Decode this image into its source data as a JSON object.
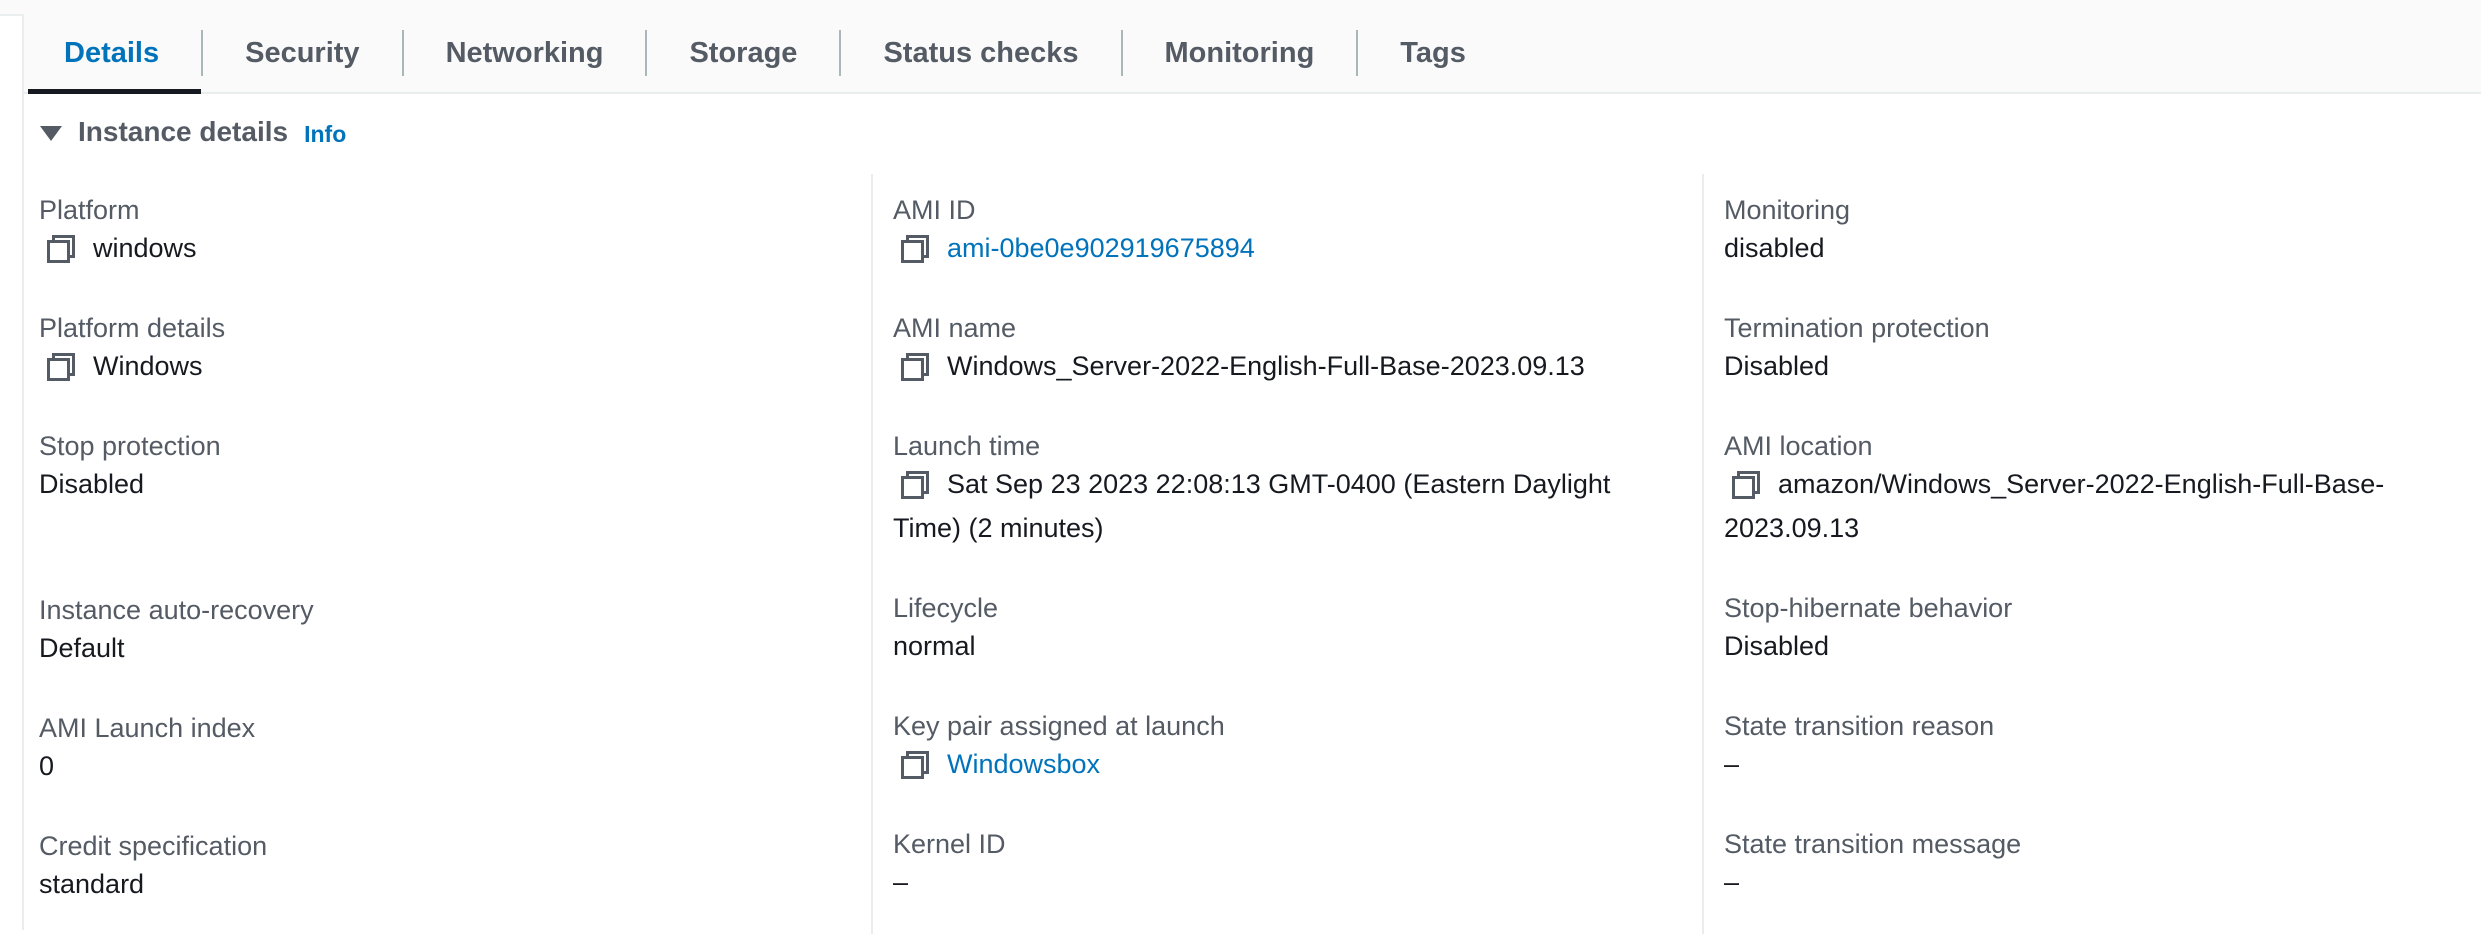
{
  "tabs": [
    {
      "label": "Details",
      "active": true
    },
    {
      "label": "Security"
    },
    {
      "label": "Networking"
    },
    {
      "label": "Storage"
    },
    {
      "label": "Status checks"
    },
    {
      "label": "Monitoring"
    },
    {
      "label": "Tags"
    }
  ],
  "section": {
    "title": "Instance details",
    "info": "Info"
  },
  "col1": [
    {
      "label": "Platform",
      "value": "windows",
      "copy": true
    },
    {
      "label": "Platform details",
      "value": "Windows",
      "copy": true
    },
    {
      "label": "Stop protection",
      "value": "Disabled"
    },
    {
      "label": "Instance auto-recovery",
      "value": "Default"
    },
    {
      "label": "AMI Launch index",
      "value": "0"
    },
    {
      "label": "Credit specification",
      "value": "standard"
    }
  ],
  "col2": [
    {
      "label": "AMI ID",
      "value": "ami-0be0e902919675894",
      "copy": true,
      "link": true
    },
    {
      "label": "AMI name",
      "value": "Windows_Server-2022-English-Full-Base-2023.09.13",
      "copy": true
    },
    {
      "label": "Launch time",
      "value_line1": "Sat Sep 23 2023 22:08:13 GMT-0400 (Eastern Daylight",
      "value_line2": "Time) (2 minutes)",
      "copy": true
    },
    {
      "label": "Lifecycle",
      "value": "normal"
    },
    {
      "label": "Key pair assigned at launch",
      "value": "Windowsbox",
      "copy": true,
      "link": true
    },
    {
      "label": "Kernel ID",
      "value": "–"
    }
  ],
  "col3": [
    {
      "label": "Monitoring",
      "value": "disabled"
    },
    {
      "label": "Termination protection",
      "value": "Disabled"
    },
    {
      "label": "AMI location",
      "value_line1": "amazon/Windows_Server-2022-English-Full-Base-",
      "value_line2": "2023.09.13",
      "copy": true
    },
    {
      "label": "Stop-hibernate behavior",
      "value": "Disabled"
    },
    {
      "label": "State transition reason",
      "value": "–"
    },
    {
      "label": "State transition message",
      "value": "–"
    }
  ],
  "colors": {
    "link": "#0073bb",
    "label": "#545b64",
    "text": "#16191f",
    "border": "#eaeded"
  },
  "icons": {
    "copy": "copy-icon",
    "caret": "caret-down-icon"
  }
}
